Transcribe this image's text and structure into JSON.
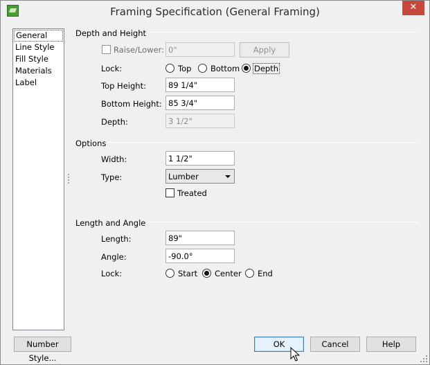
{
  "window": {
    "title": "Framing Specification (General Framing)",
    "close_glyph": "✕"
  },
  "nav": {
    "items": [
      "General",
      "Line Style",
      "Fill Style",
      "Materials",
      "Label"
    ],
    "selected": "General"
  },
  "depth_height": {
    "section_label": "Depth and Height",
    "raise_lower_label": "Raise/Lower:",
    "raise_lower_checked": false,
    "raise_lower_value": "0\"",
    "apply_label": "Apply",
    "lock_label": "Lock:",
    "lock_options": [
      "Top",
      "Bottom",
      "Depth"
    ],
    "lock_selected": "Depth",
    "top_height_label": "Top Height:",
    "top_height_value": "89 1/4\"",
    "bottom_height_label": "Bottom Height:",
    "bottom_height_value": "85 3/4\"",
    "depth_label": "Depth:",
    "depth_value": "3 1/2\""
  },
  "options": {
    "section_label": "Options",
    "width_label": "Width:",
    "width_value": "1 1/2\"",
    "type_label": "Type:",
    "type_value": "Lumber",
    "treated_label": "Treated",
    "treated_checked": false
  },
  "length_angle": {
    "section_label": "Length and Angle",
    "length_label": "Length:",
    "length_value": "89\"",
    "angle_label": "Angle:",
    "angle_value": "-90.0°",
    "lock_label": "Lock:",
    "lock_options": [
      "Start",
      "Center",
      "End"
    ],
    "lock_selected": "Center"
  },
  "footer": {
    "number_style_label": "Number Style...",
    "ok_label": "OK",
    "cancel_label": "Cancel",
    "help_label": "Help"
  },
  "colors": {
    "window_bg": "#f0f0f0",
    "close_button": "#c7483a",
    "default_button_border": "#3c7fb1",
    "app_icon": "#4c9a3a"
  }
}
